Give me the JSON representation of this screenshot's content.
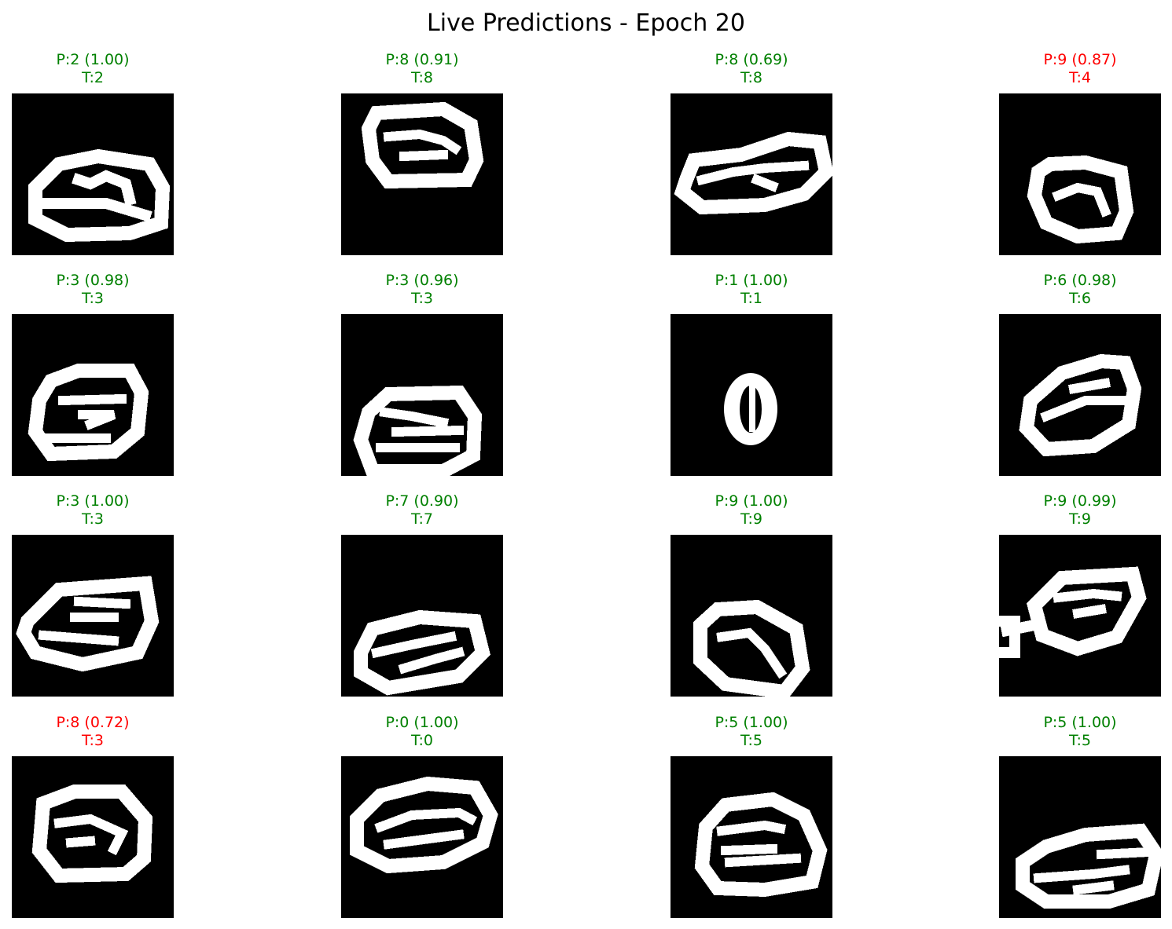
{
  "title": "Live Predictions - Epoch 20",
  "colors": {
    "correct": "#008000",
    "incorrect": "#ff0000",
    "digit_background": "#000000",
    "digit_stroke": "#ffffff"
  },
  "samples": [
    {
      "pred": "P:2 (1.00)",
      "truth": "T:2",
      "correct": true
    },
    {
      "pred": "P:8 (0.91)",
      "truth": "T:8",
      "correct": true
    },
    {
      "pred": "P:8 (0.69)",
      "truth": "T:8",
      "correct": true
    },
    {
      "pred": "P:9 (0.87)",
      "truth": "T:4",
      "correct": false
    },
    {
      "pred": "P:3 (0.98)",
      "truth": "T:3",
      "correct": true
    },
    {
      "pred": "P:3 (0.96)",
      "truth": "T:3",
      "correct": true
    },
    {
      "pred": "P:1 (1.00)",
      "truth": "T:1",
      "correct": true
    },
    {
      "pred": "P:6 (0.98)",
      "truth": "T:6",
      "correct": true
    },
    {
      "pred": "P:3 (1.00)",
      "truth": "T:3",
      "correct": true
    },
    {
      "pred": "P:7 (0.90)",
      "truth": "T:7",
      "correct": true
    },
    {
      "pred": "P:9 (1.00)",
      "truth": "T:9",
      "correct": true
    },
    {
      "pred": "P:9 (0.99)",
      "truth": "T:9",
      "correct": true
    },
    {
      "pred": "P:8 (0.72)",
      "truth": "T:3",
      "correct": false
    },
    {
      "pred": "P:0 (1.00)",
      "truth": "T:0",
      "correct": true
    },
    {
      "pred": "P:5 (1.00)",
      "truth": "T:5",
      "correct": true
    },
    {
      "pred": "P:5 (1.00)",
      "truth": "T:5",
      "correct": true
    }
  ]
}
